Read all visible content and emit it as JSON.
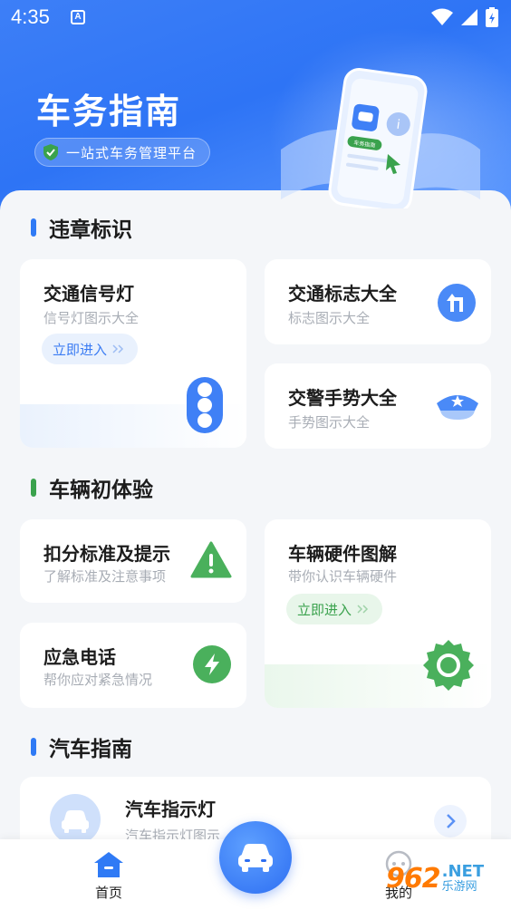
{
  "status_bar": {
    "time": "4:35",
    "notification_letter": "A"
  },
  "header": {
    "title": "车务指南",
    "subtitle": "一站式车务管理平台",
    "phone_badge_text": "车务指南"
  },
  "sections": [
    {
      "title": "违章标识",
      "accent": "#2f7af5"
    },
    {
      "title": "车辆初体验",
      "accent": "#3aa24d"
    },
    {
      "title": "汽车指南",
      "accent": "#2f7af5"
    }
  ],
  "violation_cards": {
    "traffic_light": {
      "title": "交通信号灯",
      "subtitle": "信号灯图示大全",
      "button": "立即进入",
      "icon": "traffic-light-icon"
    },
    "traffic_sign": {
      "title": "交通标志大全",
      "subtitle": "标志图示大全",
      "icon": "turn-sign-icon"
    },
    "police_gesture": {
      "title": "交警手势大全",
      "subtitle": "手势图示大全",
      "icon": "police-cap-icon"
    }
  },
  "vehicle_cards": {
    "points": {
      "title": "扣分标准及提示",
      "subtitle": "了解标准及注意事项",
      "icon": "warning-icon"
    },
    "hardware": {
      "title": "车辆硬件图解",
      "subtitle": "带你认识车辆硬件",
      "button": "立即进入",
      "icon": "gear-icon"
    },
    "emergency": {
      "title": "应急电话",
      "subtitle": "帮你应对紧急情况",
      "icon": "lightning-icon"
    }
  },
  "guide_list": [
    {
      "title": "汽车指示灯",
      "subtitle": "汽车指示灯图示",
      "icon": "car-icon"
    }
  ],
  "bottom_nav": {
    "home": "首页",
    "mine": "我的"
  },
  "watermark": {
    "number": "962",
    "domain": ".NET",
    "cn": "乐游网"
  },
  "colors": {
    "primary": "#2f7af5",
    "green": "#3aa24d",
    "orange_watermark": "#ff7a00"
  }
}
